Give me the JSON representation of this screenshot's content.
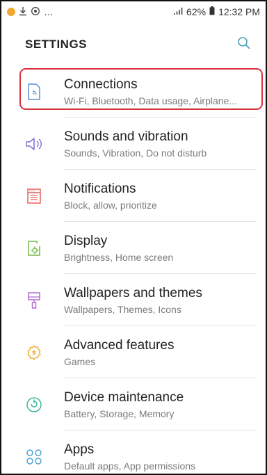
{
  "status_bar": {
    "left_text": "…",
    "battery": "62%",
    "time": "12:32 PM"
  },
  "header": {
    "title": "SETTINGS"
  },
  "items": [
    {
      "title": "Connections",
      "subtitle": "Wi-Fi, Bluetooth, Data usage, Airplane...",
      "icon": "connections-icon",
      "color": "#5b8fd6"
    },
    {
      "title": "Sounds and vibration",
      "subtitle": "Sounds, Vibration, Do not disturb",
      "icon": "speaker-icon",
      "color": "#7a72d8"
    },
    {
      "title": "Notifications",
      "subtitle": "Block, allow, prioritize",
      "icon": "notifications-icon",
      "color": "#e8605a"
    },
    {
      "title": "Display",
      "subtitle": "Brightness, Home screen",
      "icon": "display-icon",
      "color": "#74b84a"
    },
    {
      "title": "Wallpapers and themes",
      "subtitle": "Wallpapers, Themes, Icons",
      "icon": "brush-icon",
      "color": "#b46ad0"
    },
    {
      "title": "Advanced features",
      "subtitle": "Games",
      "icon": "puzzle-gear-icon",
      "color": "#f0a830"
    },
    {
      "title": "Device maintenance",
      "subtitle": "Battery, Storage, Memory",
      "icon": "maintenance-icon",
      "color": "#3fb8a0"
    },
    {
      "title": "Apps",
      "subtitle": "Default apps, App permissions",
      "icon": "apps-grid-icon",
      "color": "#4a9fd8"
    }
  ]
}
